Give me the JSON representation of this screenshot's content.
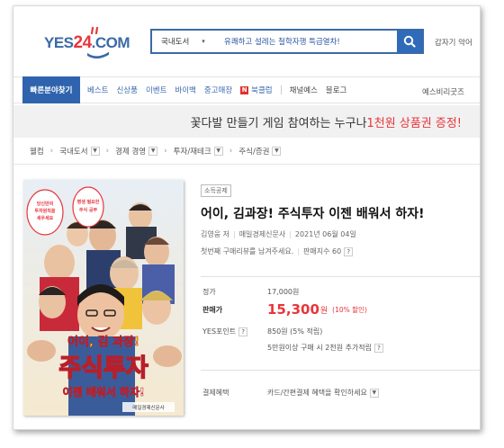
{
  "header": {
    "logo": "YES24.COM",
    "search_scope": "국내도서",
    "search_query": "유쾌하고 설레는 철학자행 특급열차!",
    "right_text": "갑자기 악어"
  },
  "nav": {
    "category_button": "빠른분야찾기",
    "items": [
      {
        "label": "베스트"
      },
      {
        "label": "신상품"
      },
      {
        "label": "이벤트"
      },
      {
        "label": "바이백"
      },
      {
        "label": "중고매장"
      }
    ],
    "book_club": "북클럽",
    "book_club_badge": "N",
    "plain_items": [
      {
        "label": "채널예스"
      },
      {
        "label": "블로그"
      }
    ],
    "right_link": "예스비리굿즈"
  },
  "banner": {
    "text_before": "꽃다발 만들기 게임 참여하는 누구나 ",
    "highlight": "1천원 상품권 증정!"
  },
  "breadcrumb": [
    {
      "label": "웰컴",
      "dropdown": false
    },
    {
      "label": "국내도서",
      "dropdown": true
    },
    {
      "label": "경제 경영",
      "dropdown": true
    },
    {
      "label": "투자/재테크",
      "dropdown": true
    },
    {
      "label": "주식/증권",
      "dropdown": true
    }
  ],
  "cover": {
    "line1": "어이, 김 과장!",
    "line2": "주식투자",
    "line3": "이젠 배워서 하자!",
    "publisher": "매일경제신문사",
    "bubble_left": "당신만의 투자원칙을 세우세요",
    "bubble_right": "평생 필요한 주식 공부"
  },
  "product": {
    "tag": "소득공제",
    "title": "어이, 김과장! 주식투자 이젠 배워서 하자!",
    "author": "김영웅 저",
    "publisher": "매일경제신문사",
    "date": "2021년 06월 04일",
    "review_prompt": "첫번째 구매리뷰를 남겨주세요.",
    "sales_index": "판매지수 60",
    "help_icon": "?"
  },
  "price": {
    "list_label": "정가",
    "list_price": "17,000원",
    "sale_label": "판매가",
    "sale_price": "15,300",
    "sale_unit": "원",
    "discount": "(10% 할인)",
    "points_label": "YES포인트",
    "points_value": "850원 (5% 적립)",
    "extra_points": "5만원이상 구매 시 2천원 추가적립",
    "payment_label": "결제혜택",
    "payment_text": "카드/간편결제 혜택을 확인하세요"
  },
  "colors": {
    "brand_blue": "#2f63ad",
    "accent_red": "#e8353b",
    "cover_yellow": "#f3d21c"
  }
}
